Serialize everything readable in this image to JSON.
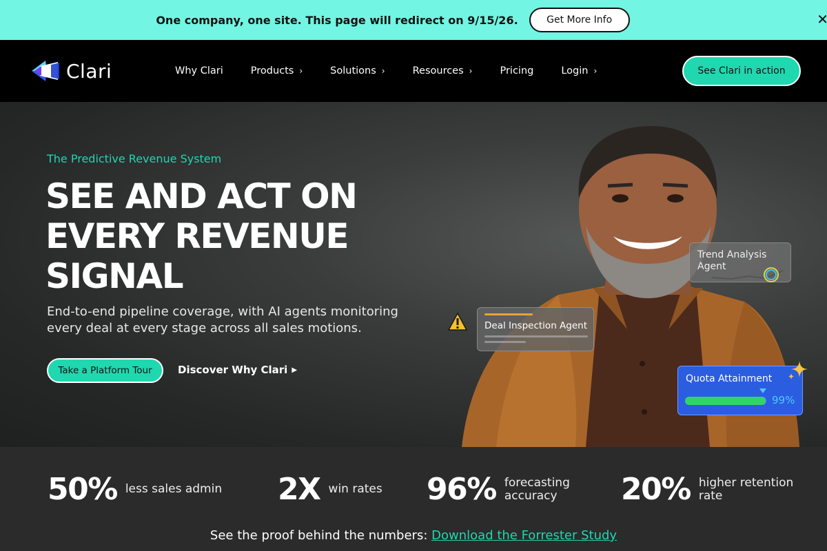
{
  "banner": {
    "text": "One company, one site. This page will redirect on 9/15/26.",
    "button": "Get More Info",
    "close_icon": "close-icon"
  },
  "nav": {
    "logo_text": "Clari",
    "items": [
      {
        "label": "Why Clari",
        "has_chevron": false
      },
      {
        "label": "Products",
        "has_chevron": true
      },
      {
        "label": "Solutions",
        "has_chevron": true
      },
      {
        "label": "Resources",
        "has_chevron": true
      },
      {
        "label": "Pricing",
        "has_chevron": false
      },
      {
        "label": "Login",
        "has_chevron": true
      }
    ],
    "cta": "See Clari in action"
  },
  "hero": {
    "eyebrow": "The Predictive Revenue System",
    "headline_lines": [
      "SEE AND ACT ON",
      "EVERY REVENUE",
      "SIGNAL"
    ],
    "subtext": "End-to-end pipeline coverage, with AI agents monitoring every deal at every stage across all sales motions.",
    "primary_cta": "Take a Platform Tour",
    "secondary_link": "Discover Why Clari",
    "cards": {
      "trend": "Trend Analysis Agent",
      "deal": "Deal Inspection Agent",
      "quota_title": "Quota Attainment",
      "quota_pct": "99%",
      "quota_value": 0.99
    }
  },
  "stats": [
    {
      "value": "50%",
      "label_lines": [
        "less sales admin"
      ]
    },
    {
      "value": "2X",
      "label_lines": [
        "win rates"
      ]
    },
    {
      "value": "96%",
      "label_lines": [
        "forecasting",
        "accuracy"
      ]
    },
    {
      "value": "20%",
      "label_lines": [
        "higher retention",
        "rate"
      ]
    }
  ],
  "proof": {
    "text": "See the proof behind the numbers:",
    "link": "Download the Forrester Study"
  },
  "colors": {
    "banner_bg": "#72f5e2",
    "accent": "#1fd8b0",
    "quota_card": "#2b5de0"
  }
}
